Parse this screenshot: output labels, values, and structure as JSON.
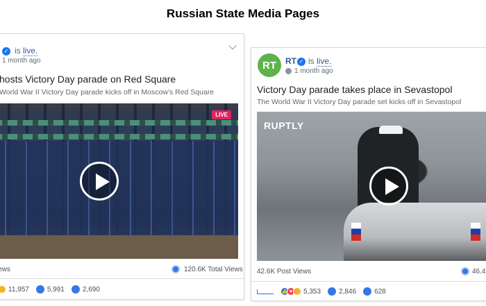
{
  "page_title": "Russian State Media Pages",
  "posts": [
    {
      "status_prefix": "is",
      "status_link": "live.",
      "time": "1 month ago",
      "headline": "hosts Victory Day parade on Red Square",
      "subline": "World War II Victory Day parade kicks off in Moscow's Red Square",
      "badge": "LIVE",
      "post_views": "iews",
      "total_views": "120.6K Total Views",
      "reactions_count": "11,957",
      "comments_count": "5,991",
      "shares_count": "2,690"
    },
    {
      "page_name": "RT",
      "avatar_text": "RT",
      "status_prefix": "is",
      "status_link": "live.",
      "time": "1 month ago",
      "headline": "Victory Day parade takes place in Sevastopol",
      "subline": "The World War II Victory Day parade set kicks off in Sevastopol",
      "watermark": "RUPTLY",
      "post_views": "42.6K Post Views",
      "total_views": "46.4K",
      "reactions_count": "5,353",
      "comments_count": "2,846",
      "shares_count": "628"
    }
  ],
  "colors": {
    "link": "#385898",
    "accent": "#1877f2",
    "live_badge": "#e0245e",
    "rt_green": "#5db44a"
  }
}
